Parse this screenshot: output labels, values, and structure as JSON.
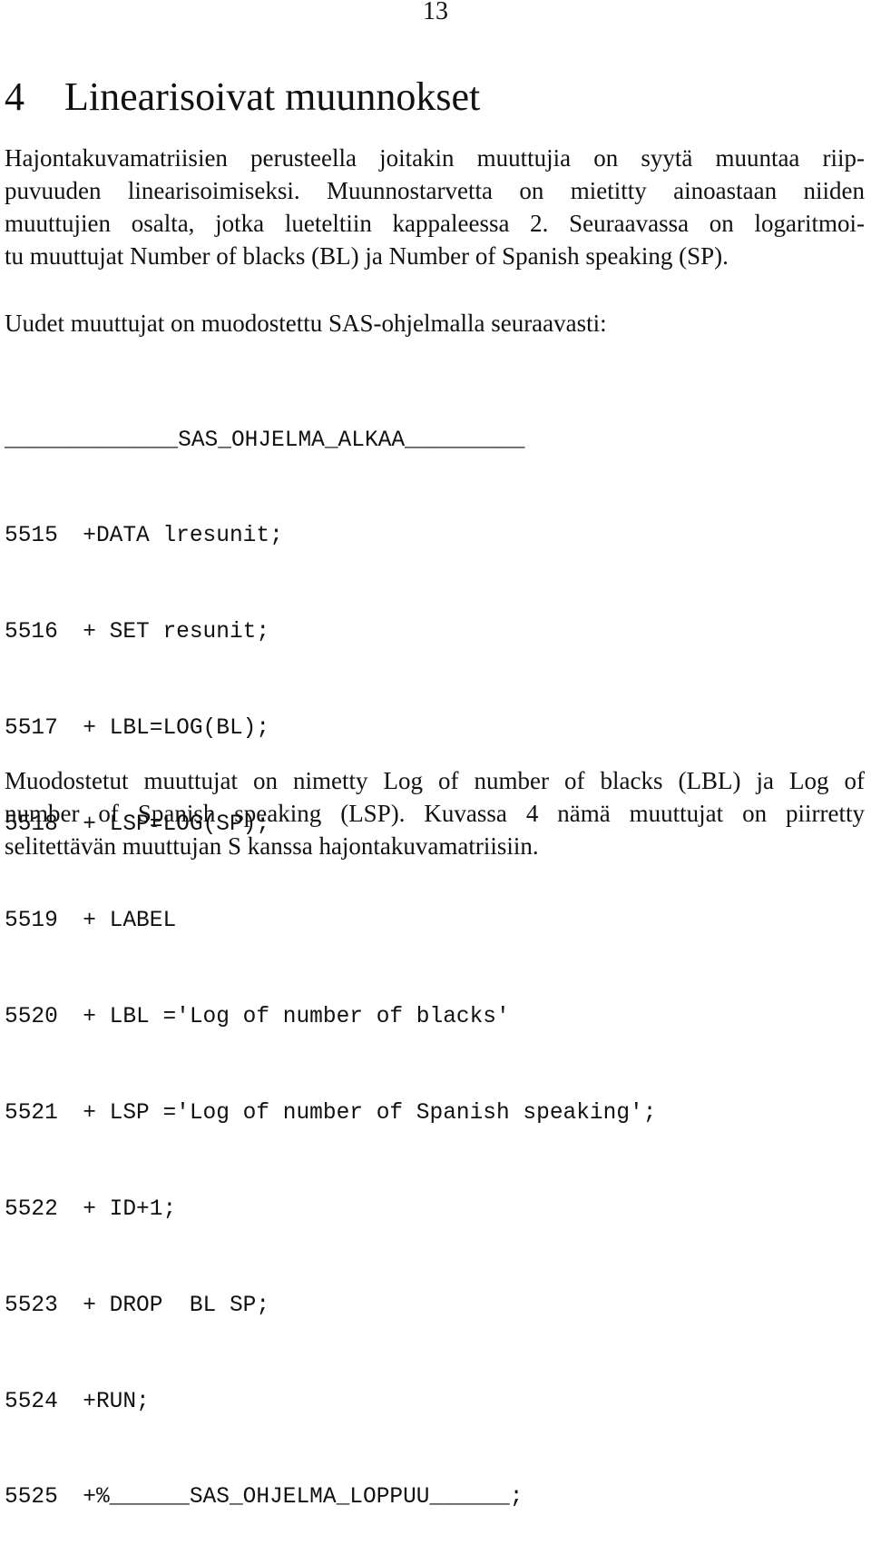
{
  "page": {
    "number": "13"
  },
  "section": {
    "number": "4",
    "title": "Linearisoivat muunnokset"
  },
  "paragraph1": {
    "lines": [
      "Hajontakuvamatriisien perusteella joitakin muuttujia on syytä muuntaa riip-",
      "puvuuden linearisoimiseksi. Muunnostarvetta on mietitty ainoastaan niiden",
      "muuttujien osalta, jotka lueteltiin kappaleessa 2. Seuraavassa on logaritmoi-",
      "tu muuttujat Number of blacks (BL) ja Number of Spanish speaking (SP)."
    ]
  },
  "paragraph2": {
    "lines": [
      "Uudet muuttujat on muodostettu SAS-ohjelmalla seuraavasti:"
    ]
  },
  "code_listing": {
    "header": "_____________SAS_OHJELMA_ALKAA_________",
    "lines": [
      {
        "line_no": "5515",
        "code": "+DATA lresunit;"
      },
      {
        "line_no": "5516",
        "code": "+ SET resunit;"
      },
      {
        "line_no": "5517",
        "code": "+ LBL=LOG(BL);"
      },
      {
        "line_no": "5518",
        "code": "+ LSP=LOG(SP);"
      },
      {
        "line_no": "5519",
        "code": "+ LABEL"
      },
      {
        "line_no": "5520",
        "code": "+ LBL ='Log of number of blacks'"
      },
      {
        "line_no": "5521",
        "code": "+ LSP ='Log of number of Spanish speaking';"
      },
      {
        "line_no": "5522",
        "code": "+ ID+1;"
      },
      {
        "line_no": "5523",
        "code": "+ DROP  BL SP;"
      },
      {
        "line_no": "5524",
        "code": "+RUN;"
      },
      {
        "line_no": "5525",
        "code": "+%______SAS_OHJELMA_LOPPUU______;"
      }
    ]
  },
  "paragraph3": {
    "lines": [
      "Muodostetut muuttujat on nimetty Log of number of blacks (LBL) ja Log of",
      "number of Spanish speaking (LSP). Kuvassa 4 nämä muuttujat on piirretty",
      "selitettävän muuttujan S kanssa hajontakuvamatriisiin."
    ]
  }
}
